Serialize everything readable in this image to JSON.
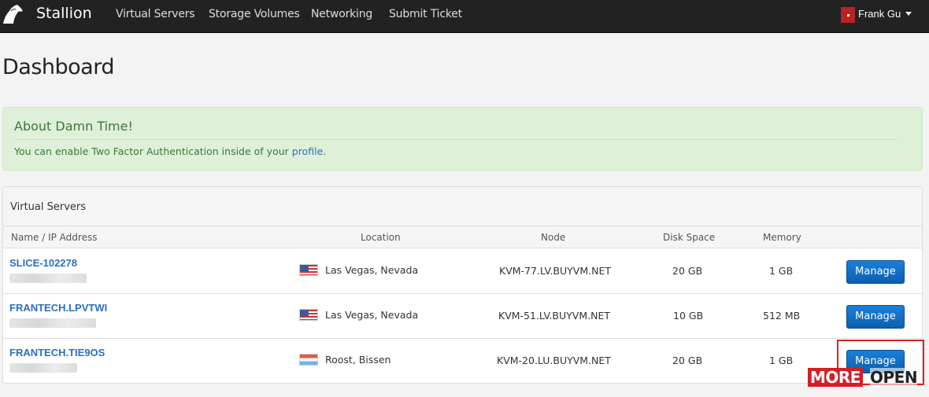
{
  "nav": {
    "brand": "Stallion",
    "links": [
      "Virtual Servers",
      "Storage Volumes",
      "Networking",
      "Submit Ticket"
    ],
    "user_name": "Frank Gu"
  },
  "page_title": "Dashboard",
  "alert": {
    "title": "About Damn Time!",
    "text": "You can enable Two Factor Authentication inside of your ",
    "link": "profile",
    "suffix": "."
  },
  "panel": {
    "title": "Virtual Servers",
    "columns": [
      "Name / IP Address",
      "Location",
      "Node",
      "Disk Space",
      "Memory"
    ],
    "rows": [
      {
        "name": "SLICE-102278",
        "location": "Las Vegas, Nevada",
        "flag": "us-flag",
        "node": "KVM-77.LV.BUYVM.NET",
        "disk": "20 GB",
        "memory": "1 GB",
        "action": "Manage"
      },
      {
        "name": "FRANTECH.LPVTWI",
        "location": "Las Vegas, Nevada",
        "flag": "us-flag",
        "node": "KVM-51.LV.BUYVM.NET",
        "disk": "10 GB",
        "memory": "512 MB",
        "action": "Manage"
      },
      {
        "name": "FRANTECH.TIE9OS",
        "location": "Roost, Bissen",
        "flag": "lu-flag",
        "node": "KVM-20.LU.BUYVM.NET",
        "disk": "20 GB",
        "memory": "1 GB",
        "action": "Manage"
      }
    ]
  },
  "watermark": {
    "left": "MORE",
    "right": "OPEN"
  },
  "colors": {
    "navbar": "#222222",
    "alert_bg": "#dff0d8",
    "link": "#2a6fbf",
    "button": "#0c5fb0",
    "highlight": "#e02020"
  }
}
